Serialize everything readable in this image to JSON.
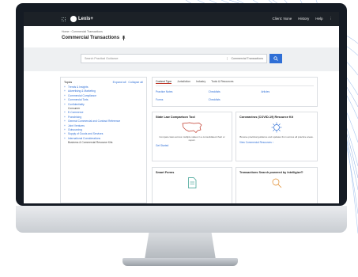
{
  "colors": {
    "accent": "#2f6fd6",
    "topbar": "#1c2127",
    "tab_underline": "#c0392b"
  },
  "topbar": {
    "logo_text": "Lexis+",
    "nav": [
      "Client: None",
      "History",
      "Help",
      "⋮"
    ]
  },
  "breadcrumb": "Home  ›  Commercial Transactions",
  "page_title": "Commercial Transactions",
  "search": {
    "placeholder": "Search Practical Guidance",
    "scope": "Commercial Transactions",
    "icon": "search-icon"
  },
  "topics": {
    "heading": "Topics",
    "expand": "Expand all",
    "collapse": "Collapse all",
    "items": [
      {
        "label": "Trends & Insights",
        "sub": false
      },
      {
        "label": "Advertising & Marketing",
        "sub": false
      },
      {
        "label": "Commercial Compliance",
        "sub": false
      },
      {
        "label": "Commercial Torts",
        "sub": false
      },
      {
        "label": "Confidentiality",
        "sub": false
      },
      {
        "label": "Consumer",
        "sub": true
      },
      {
        "label": "E-Commerce",
        "sub": false
      },
      {
        "label": "Franchising",
        "sub": false
      },
      {
        "label": "General Commercial and Contract Reference",
        "sub": false
      },
      {
        "label": "Joint Ventures",
        "sub": false
      },
      {
        "label": "Outsourcing",
        "sub": false
      },
      {
        "label": "Supply of Goods and Services",
        "sub": false
      },
      {
        "label": "International Considerations",
        "sub": false
      },
      {
        "label": "Business & Commercial Resource Kits",
        "sub": true
      }
    ]
  },
  "content_tabs": {
    "tabs": [
      "Content Type",
      "Jurisdiction",
      "Industry",
      "Tools & Resources"
    ],
    "links": [
      "Practice Notes",
      "Checklists",
      "Articles",
      "Forms",
      "Checklists"
    ]
  },
  "features": [
    {
      "title": "State Law Comparison Tool",
      "desc": "Compare laws across multiple states in a consolidated chart or report.",
      "link": "Get Started",
      "icon": "us-map-icon"
    },
    {
      "title": "Coronavirus (COVID-19) Resource Kit",
      "desc": "Browse practical guidance and updates from across all practice areas.",
      "link": "View Commercial Resources  ›",
      "icon": "virus-icon"
    },
    {
      "title": "Smart Forms",
      "icon": "document-icon"
    },
    {
      "title": "Transactions Search powered by Intelligize®",
      "icon": "search-doc-icon"
    }
  ]
}
